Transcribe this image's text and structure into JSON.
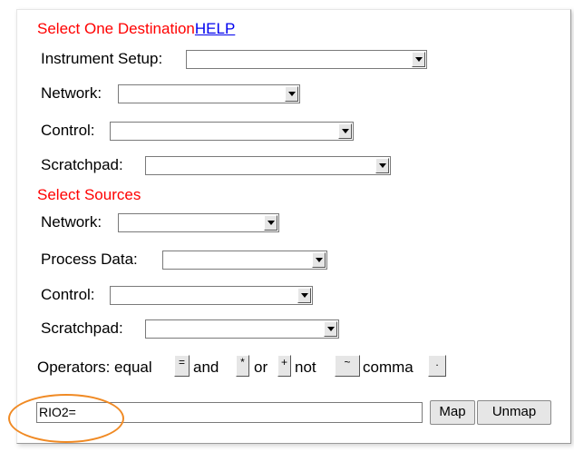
{
  "destination": {
    "heading": "Select One Destination",
    "help_link": "HELP",
    "instrument_setup_label": "Instrument Setup:",
    "network_label": "Network:",
    "control_label": "Control:",
    "scratchpad_label": "Scratchpad:",
    "instrument_setup_value": "",
    "network_value": "",
    "control_value": "",
    "scratchpad_value": ""
  },
  "sources": {
    "heading": "Select Sources",
    "network_label": "Network:",
    "process_data_label": "Process Data:",
    "control_label": "Control:",
    "scratchpad_label": "Scratchpad:",
    "network_value": "",
    "process_data_value": "",
    "control_value": "",
    "scratchpad_value": ""
  },
  "operators": {
    "label": "Operators: equal",
    "equal_symbol": "=",
    "and_label": "and",
    "and_symbol": "*",
    "or_label": "or",
    "or_symbol": "+",
    "not_label": "not",
    "not_symbol": "~",
    "comma_label": "comma",
    "comma_symbol": "."
  },
  "expression": {
    "value": "RIO2="
  },
  "buttons": {
    "map": "Map",
    "unmap": "Unmap"
  },
  "colors": {
    "heading": "#ff0000",
    "link": "#0000ee",
    "highlight_ellipse": "#f08a24"
  }
}
